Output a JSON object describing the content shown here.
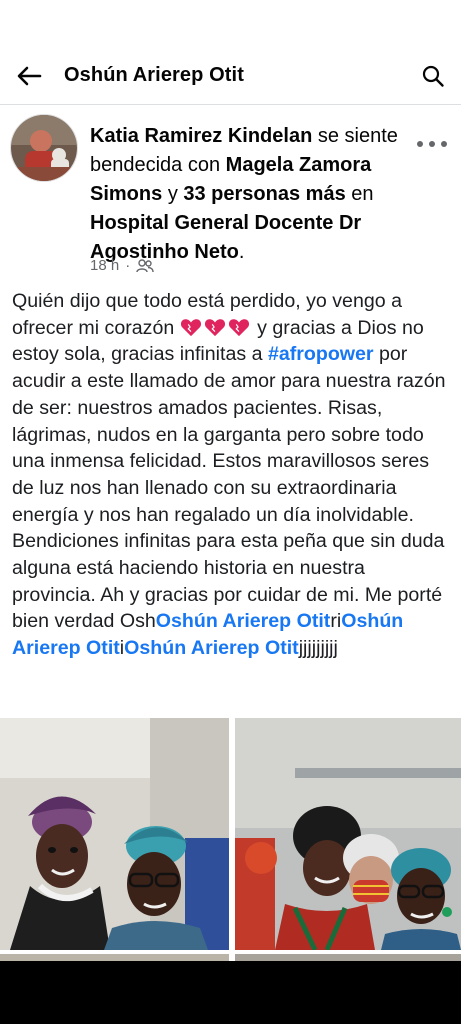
{
  "header": {
    "title": "Oshún  Arierep Otit",
    "back_icon": "arrow-left-icon",
    "search_icon": "search-icon"
  },
  "post": {
    "author": "Katia Ramirez Kindelan",
    "feeling": "se siente bendecida con",
    "tagged_person": "Magela Zamora Simons",
    "and": "y",
    "others": "33 personas más",
    "location_prefix": "en",
    "location": "Hospital General Docente Dr Agostinho Neto",
    "period": ".",
    "time": "18 h",
    "audience_icon": "friends-icon",
    "body": {
      "p1": "Quién dijo que todo está perdido, yo vengo a ofrecer mi corazón",
      "p2": " y gracias a Dios no estoy sola, gracias infinitas a ",
      "hashtag": "#afropower",
      "p3": " por acudir a este llamado de amor para nuestra razón de ser: nuestros amados pacientes. Risas, lágrimas, nudos en la garganta pero sobre todo una inmensa felicidad. Estos maravillosos seres de luz nos han llenado con su extraordinaria energía y nos han regalado un día inolvidable. Bendiciones infinitas para esta peña que sin duda alguna está haciendo historia en nuestra provincia. Ah y gracias por cuidar de mi. Me porté bien verdad Osh",
      "mention": "Oshún  Arierep Otit",
      "p4": "ri",
      "p5": "i",
      "p6": "jjjjjjjjj"
    }
  },
  "colors": {
    "link": "#1877f2",
    "text": "#1c1e21",
    "meta": "#65676b",
    "heart": "#e0245e"
  }
}
